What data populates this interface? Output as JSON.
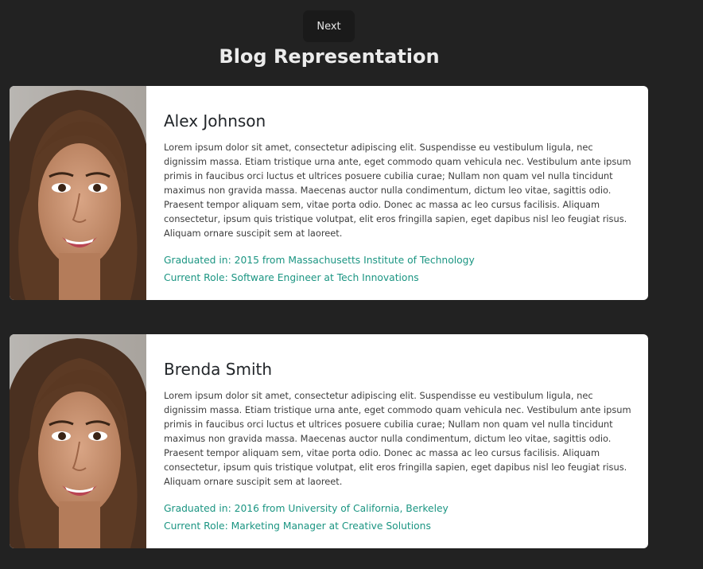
{
  "header": {
    "next_label": "Next",
    "title": "Blog Representation"
  },
  "posts": [
    {
      "name": "Alex Johnson",
      "bio": "Lorem ipsum dolor sit amet, consectetur adipiscing elit. Suspendisse eu vestibulum ligula, nec dignissim massa. Etiam tristique urna ante, eget commodo quam vehicula nec. Vestibulum ante ipsum primis in faucibus orci luctus et ultrices posuere cubilia curae; Nullam non quam vel nulla tincidunt maximus non gravida massa. Maecenas auctor nulla condimentum, dictum leo vitae, sagittis odio. Praesent tempor aliquam sem, vitae porta odio. Donec ac massa ac leo cursus facilisis. Aliquam consectetur, ipsum quis tristique volutpat, elit eros fringilla sapien, eget dapibus nisl leo feugiat risus. Aliquam ornare suscipit sem at laoreet.",
      "graduated": "Graduated in: 2015 from Massachusetts Institute of Technology",
      "role": "Current Role: Software Engineer at Tech Innovations"
    },
    {
      "name": "Brenda Smith",
      "bio": "Lorem ipsum dolor sit amet, consectetur adipiscing elit. Suspendisse eu vestibulum ligula, nec dignissim massa. Etiam tristique urna ante, eget commodo quam vehicula nec. Vestibulum ante ipsum primis in faucibus orci luctus et ultrices posuere cubilia curae; Nullam non quam vel nulla tincidunt maximus non gravida massa. Maecenas auctor nulla condimentum, dictum leo vitae, sagittis odio. Praesent tempor aliquam sem, vitae porta odio. Donec ac massa ac leo cursus facilisis. Aliquam consectetur, ipsum quis tristique volutpat, elit eros fringilla sapien, eget dapibus nisl leo feugiat risus. Aliquam ornare suscipit sem at laoreet.",
      "graduated": "Graduated in: 2016 from University of California, Berkeley",
      "role": "Current Role: Marketing Manager at Creative Solutions"
    }
  ],
  "colors": {
    "page_background": "#222222",
    "card_background": "#ffffff",
    "accent_text": "#1b9582",
    "button_background": "#1a1a1a"
  }
}
